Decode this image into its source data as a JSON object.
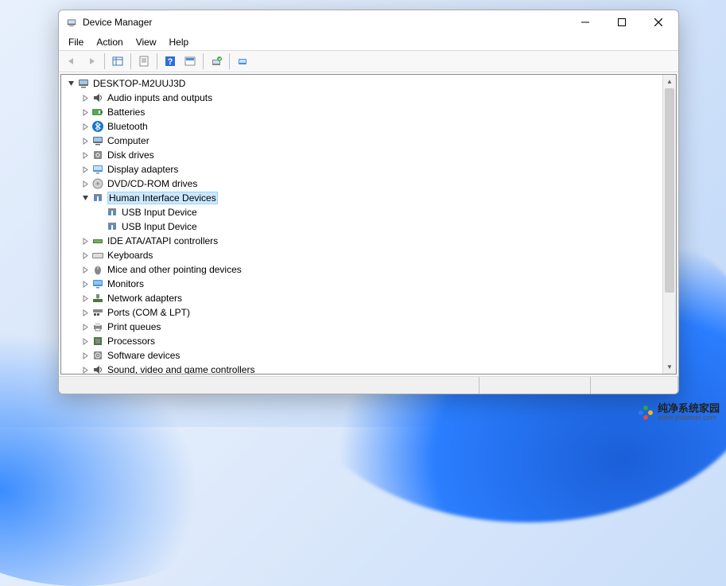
{
  "window": {
    "title": "Device Manager"
  },
  "menubar": {
    "items": [
      "File",
      "Action",
      "View",
      "Help"
    ]
  },
  "toolbar": {
    "back": "back-icon",
    "forward": "forward-icon",
    "show_hide": "show-hide-icon",
    "properties": "properties-icon",
    "help": "help-icon",
    "action": "action-icon",
    "scan": "scan-icon",
    "view_devices": "view-icon"
  },
  "tree": {
    "root": {
      "label": "DESKTOP-M2UUJ3D",
      "icon": "computer-icon",
      "expanded": true,
      "children": [
        {
          "label": "Audio inputs and outputs",
          "icon": "audio-icon",
          "expandable": true
        },
        {
          "label": "Batteries",
          "icon": "battery-icon",
          "expandable": true
        },
        {
          "label": "Bluetooth",
          "icon": "bluetooth-icon",
          "expandable": true
        },
        {
          "label": "Computer",
          "icon": "computer-icon",
          "expandable": true
        },
        {
          "label": "Disk drives",
          "icon": "disk-icon",
          "expandable": true
        },
        {
          "label": "Display adapters",
          "icon": "display-icon",
          "expandable": true
        },
        {
          "label": "DVD/CD-ROM drives",
          "icon": "cdrom-icon",
          "expandable": true
        },
        {
          "label": "Human Interface Devices",
          "icon": "hid-icon",
          "expandable": true,
          "expanded": true,
          "selected": true,
          "children": [
            {
              "label": "USB Input Device",
              "icon": "hid-icon"
            },
            {
              "label": "USB Input Device",
              "icon": "hid-icon"
            }
          ]
        },
        {
          "label": "IDE ATA/ATAPI controllers",
          "icon": "ide-icon",
          "expandable": true
        },
        {
          "label": "Keyboards",
          "icon": "keyboard-icon",
          "expandable": true
        },
        {
          "label": "Mice and other pointing devices",
          "icon": "mouse-icon",
          "expandable": true
        },
        {
          "label": "Monitors",
          "icon": "monitor-icon",
          "expandable": true
        },
        {
          "label": "Network adapters",
          "icon": "network-icon",
          "expandable": true
        },
        {
          "label": "Ports (COM & LPT)",
          "icon": "ports-icon",
          "expandable": true
        },
        {
          "label": "Print queues",
          "icon": "printer-icon",
          "expandable": true
        },
        {
          "label": "Processors",
          "icon": "cpu-icon",
          "expandable": true
        },
        {
          "label": "Software devices",
          "icon": "software-icon",
          "expandable": true
        },
        {
          "label": "Sound, video and game controllers",
          "icon": "sound-icon",
          "expandable": true
        }
      ]
    }
  },
  "watermark": {
    "name": "纯净系统家园",
    "url": "www.yidaimei.com"
  }
}
